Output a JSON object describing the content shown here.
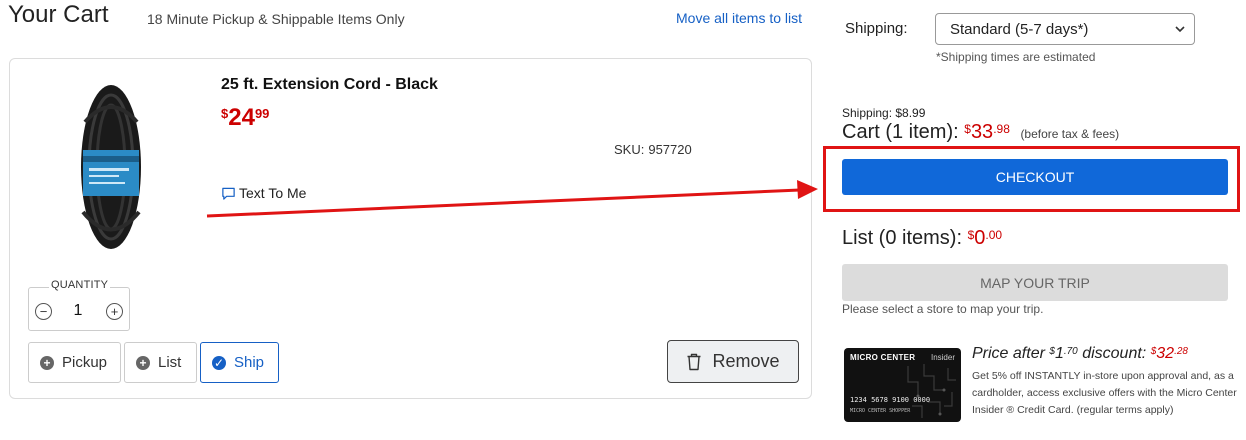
{
  "header": {
    "title": "Your Cart",
    "subtitle": "18 Minute Pickup & Shippable Items Only",
    "move_all_link": "Move all items to list"
  },
  "item": {
    "name": "25 ft. Extension Cord - Black",
    "price_symbol": "$",
    "price_dollars": "24",
    "price_cents": "99",
    "sku_label": "SKU:",
    "sku_value": "957720",
    "text_to_me": "Text To Me",
    "quantity_label": "QUANTITY",
    "quantity_value": "1",
    "qty_minus": "−",
    "qty_plus": "+",
    "options": {
      "pickup": "Pickup",
      "list": "List",
      "ship": "Ship",
      "selected": "Ship"
    },
    "remove_label": "Remove"
  },
  "summary": {
    "shipping_label": "Shipping:",
    "shipping_selected": "Standard (5-7 days*)",
    "shipping_note": "*Shipping times are estimated",
    "shipping_fee": "Shipping: $8.99",
    "cart_label": "Cart (1 item):",
    "cart_symbol": "$",
    "cart_dollars": "33",
    "cart_cents": ".98",
    "before_tax": "(before tax & fees)",
    "checkout_label": "CHECKOUT",
    "list_label": "List (0 items):",
    "list_symbol": "$",
    "list_dollars": "0",
    "list_cents": ".00",
    "map_label": "MAP YOUR TRIP",
    "map_note": "Please select a store to map your trip."
  },
  "promo": {
    "card_brand": "MICRO CENTER",
    "card_insider": "Insider",
    "card_number": "1234 5678 9100 0000",
    "card_holder": "MICRO CENTER SHOPPER",
    "title_prefix": "Price after",
    "discount_symbol": "$",
    "discount_dollars": "1",
    "discount_cents": ".70",
    "title_middle": "discount:",
    "final_symbol": "$",
    "final_dollars": "32",
    "final_cents": ".28",
    "text": "Get 5% off INSTANTLY in-store upon approval and, as a cardholder, access exclusive offers with the Micro Center Insider ® Credit Card. (regular terms apply)"
  },
  "colors": {
    "accent_blue": "#1068d9",
    "price_red": "#cc0000",
    "annotation_red": "#e01414"
  },
  "icons": {
    "text_to_me": "chat-bubble-icon",
    "remove": "trash-icon",
    "dropdown": "chevron-down-icon",
    "pickup": "plus-circle-icon",
    "list": "plus-circle-icon",
    "ship": "check-circle-icon"
  }
}
